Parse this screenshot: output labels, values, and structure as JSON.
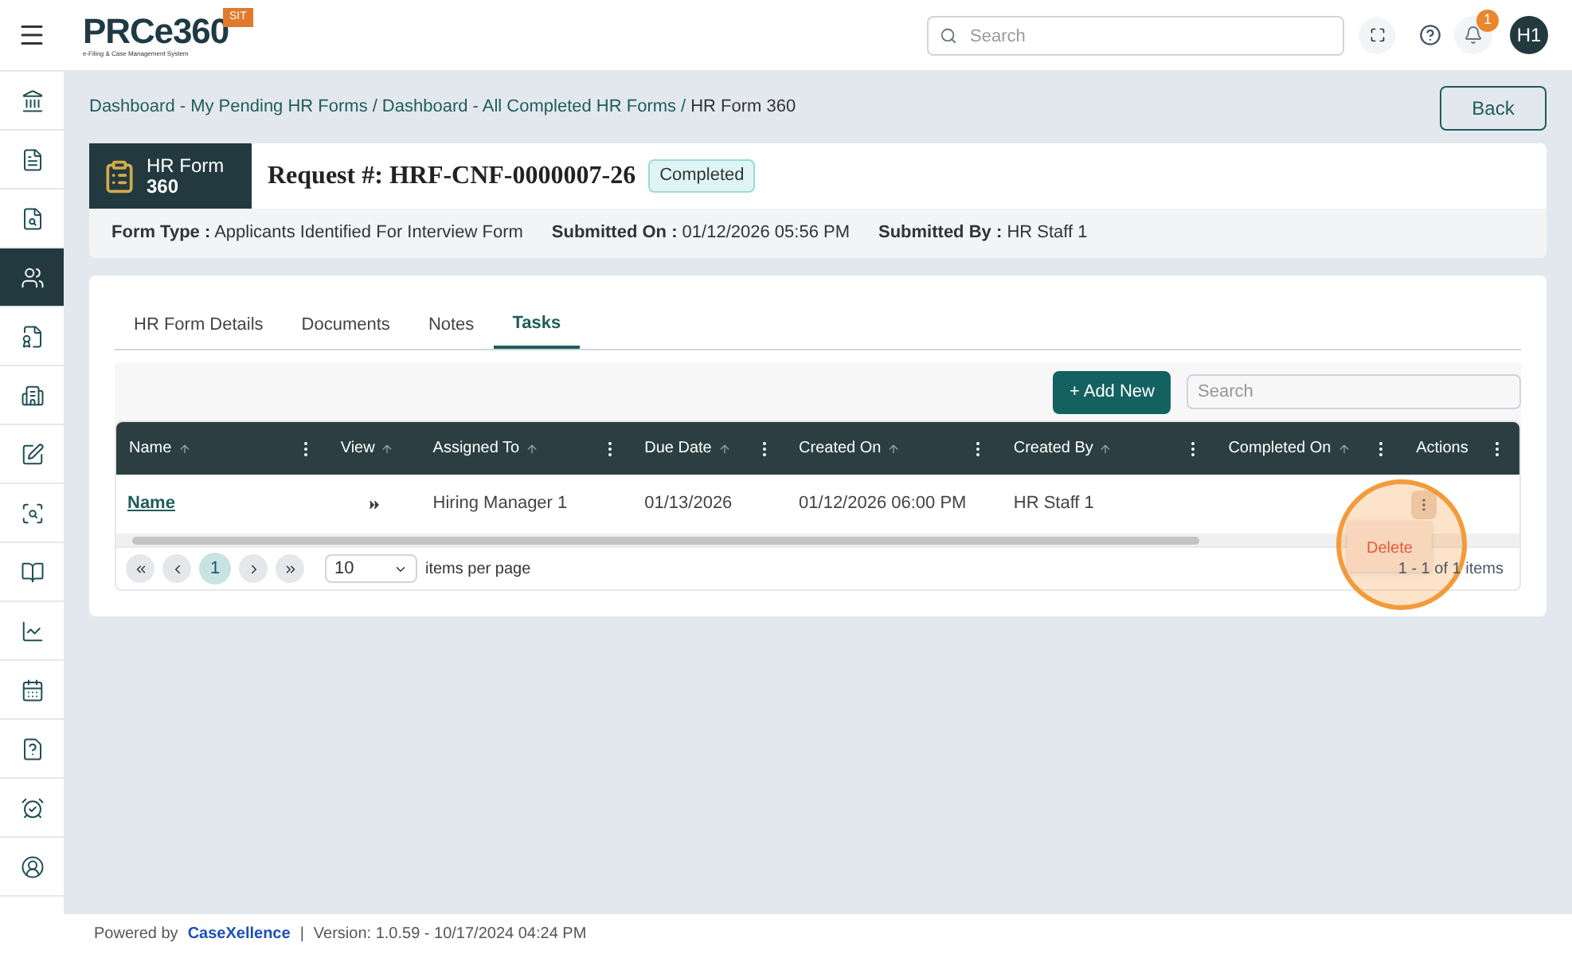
{
  "header": {
    "logo": "PRCe360",
    "logo_subtitle": "e-Filing & Case Management System",
    "env_badge": "SIT",
    "search": {
      "placeholder": "Search"
    },
    "notifications": "1",
    "avatar": "H1"
  },
  "sidebar": {
    "items": [
      {
        "selected": false
      },
      {
        "selected": false
      },
      {
        "selected": false
      },
      {
        "selected": true
      },
      {
        "selected": false
      },
      {
        "selected": false
      },
      {
        "selected": false
      },
      {
        "selected": false
      },
      {
        "selected": false
      },
      {
        "selected": false
      },
      {
        "selected": false
      },
      {
        "selected": false
      },
      {
        "selected": false
      },
      {
        "selected": false
      }
    ]
  },
  "breadcrumb": {
    "items": [
      "Dashboard - My Pending HR Forms",
      "Dashboard - All Completed HR Forms",
      "HR Form 360"
    ],
    "separator": "/"
  },
  "back_button": "Back",
  "form_badge": {
    "line1": "HR Form",
    "line2": "360"
  },
  "request": {
    "label": "Request #:",
    "id": "HRF-CNF-0000007-26",
    "status": "Completed"
  },
  "meta": [
    {
      "label": "Form Type :",
      "value": "Applicants Identified For Interview Form"
    },
    {
      "label": "Submitted On :",
      "value": "01/12/2026 05:56 PM"
    },
    {
      "label": "Submitted By :",
      "value": "HR Staff 1"
    }
  ],
  "tabs": [
    {
      "label": "HR Form Details",
      "selected": false
    },
    {
      "label": "Documents",
      "selected": false
    },
    {
      "label": "Notes",
      "selected": false
    },
    {
      "label": "Tasks",
      "selected": true
    }
  ],
  "add_button": "+ Add New",
  "table_search": {
    "placeholder": "Search"
  },
  "table": {
    "columns": [
      {
        "label": "Name",
        "sortable": true,
        "menu": true
      },
      {
        "label": "View",
        "sortable": true,
        "menu": false
      },
      {
        "label": "Assigned To",
        "sortable": true,
        "menu": true
      },
      {
        "label": "Due Date",
        "sortable": true,
        "menu": true
      },
      {
        "label": "Created On",
        "sortable": true,
        "menu": true
      },
      {
        "label": "Created By",
        "sortable": true,
        "menu": true
      },
      {
        "label": "Completed On",
        "sortable": true,
        "menu": true
      },
      {
        "label": "Actions",
        "sortable": false,
        "menu": true
      }
    ],
    "rows": [
      {
        "name": "Name",
        "assigned_to": "Hiring Manager 1",
        "due_date": "01/13/2026",
        "created_on": "01/12/2026 06:00 PM",
        "created_by": "HR Staff 1"
      }
    ]
  },
  "pager": {
    "page": "1",
    "page_size": "10",
    "per_page_label": "items per page",
    "summary": "1 - 1 of 1 items"
  },
  "action_menu": {
    "items": [
      "Delete"
    ]
  },
  "footer": {
    "powered_by": "Powered by",
    "brand": "CaseXellence",
    "separator": "|",
    "version": "Version: 1.0.59 - 10/17/2024 04:24 PM"
  }
}
